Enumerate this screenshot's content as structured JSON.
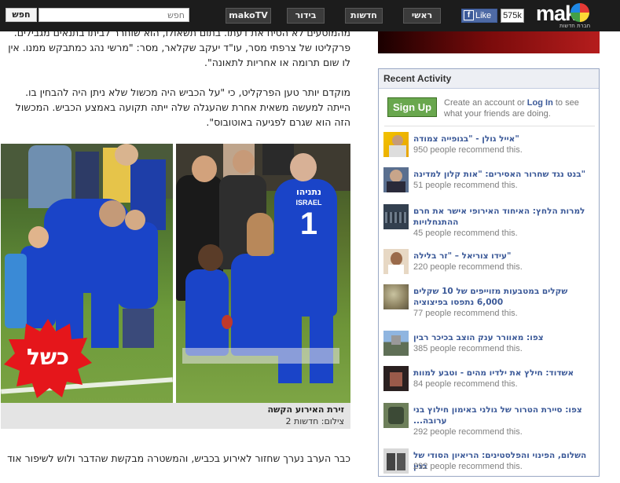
{
  "topbar": {
    "search_button": "חפש",
    "search_placeholder": "חפש",
    "nav": [
      "makoTV",
      "בידור",
      "חדשות",
      "ראשי"
    ],
    "fb_like": "Like",
    "like_count": "575k",
    "logo": "mako",
    "logo_sub": "חברת חדשות"
  },
  "article": {
    "para1": "מהמוסעים לא הסיח את דעתו. בתום תשאולו, הוא שוחרר לביתו בתנאים מגבילים. פרקליטו של צרפתי מסר, עו\"ד יעקב שקלאר, מסר: \"מרשי נהג כמתבקש ממנו. אין לו שום תרומה או אחריות לתאונה\".",
    "para2": "מוקדם יותר טען הפרקליט, כי \"על הכביש היה מכשול שלא ניתן היה להבחין בו. הייתה למעשה משאית אחרת שהעגלה שלה ייתה תקועה באמצע הכביש. המכשול הזה הוא שגרם לפגיעה באוטובוס\".",
    "para3": "כבר הערב נערך שחזור לאירוע בכביש, והמשטרה מבקשת שהדבר ולוש לשיפור אוד",
    "fail_badge": "כשל",
    "jersey_name": "נתניהו",
    "jersey_country": "ISRAEL",
    "jersey_number": "1",
    "caption_title": "זירת האירוע הקשה",
    "caption_credit": "צילום: חדשות 2"
  },
  "sidebar": {
    "header": "Recent Activity",
    "signup_button": "Sign Up",
    "signup_pre": "Create an account or ",
    "signup_login": "Log In",
    "signup_post": " to see what your friends are doing.",
    "items": [
      {
        "title": "\"אייל גולן - \"בגופייה צמודה",
        "count": "950 people recommend this."
      },
      {
        "title": "\"בנט נגד שחרור האסירים: \"אות קלון למדינה",
        "count": "51 people recommend this."
      },
      {
        "title": "למרות הלחץ: האיחוד האירופי אישר את חרם ההתנחלויות",
        "count": "45 people recommend this."
      },
      {
        "title": "\"עידו צוריאל – \"זר בלילה",
        "count": "220 people recommend this."
      },
      {
        "title": "שקלים במטבעות מזוייפים של 10 שקלים 6,000 נתפסו בפיצוציה",
        "count": "77 people recommend this."
      },
      {
        "title": "צפו: מאוורר ענק הוצב בכיכר רבין",
        "count": "385 people recommend this."
      },
      {
        "title": "אשדוד: חילץ את ילדיו מהים - וטבע למוות",
        "count": "84 people recommend this."
      },
      {
        "title": "צפו: סיירת הטרור של גולני באימון חילוץ בני ערובה...",
        "count": "292 people recommend this."
      },
      {
        "title": "השלום, הפינוי והפלסטינים: הריאיון הסודי של בגין",
        "count": "292 people recommend this."
      }
    ]
  }
}
